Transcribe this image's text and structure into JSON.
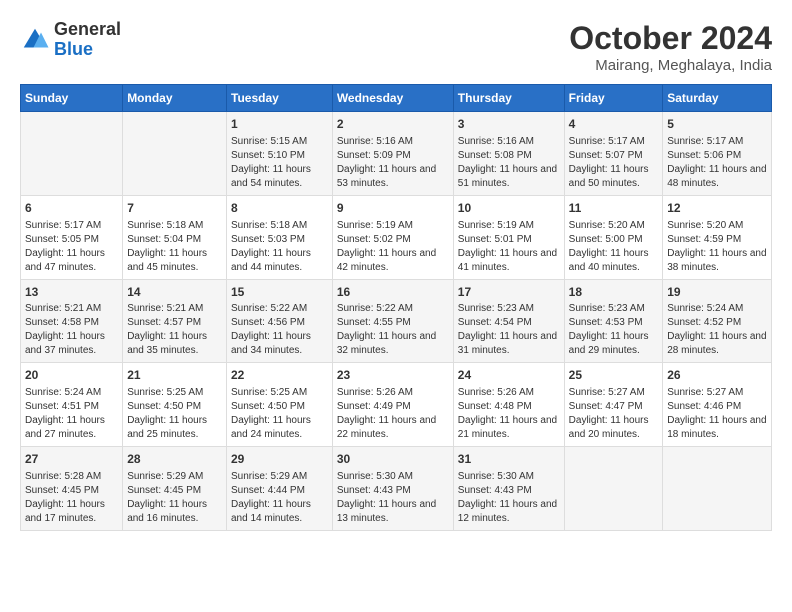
{
  "header": {
    "logo_general": "General",
    "logo_blue": "Blue",
    "month_title": "October 2024",
    "location": "Mairang, Meghalaya, India"
  },
  "weekdays": [
    "Sunday",
    "Monday",
    "Tuesday",
    "Wednesday",
    "Thursday",
    "Friday",
    "Saturday"
  ],
  "weeks": [
    [
      {
        "day": "",
        "content": ""
      },
      {
        "day": "",
        "content": ""
      },
      {
        "day": "1",
        "content": "Sunrise: 5:15 AM\nSunset: 5:10 PM\nDaylight: 11 hours and 54 minutes."
      },
      {
        "day": "2",
        "content": "Sunrise: 5:16 AM\nSunset: 5:09 PM\nDaylight: 11 hours and 53 minutes."
      },
      {
        "day": "3",
        "content": "Sunrise: 5:16 AM\nSunset: 5:08 PM\nDaylight: 11 hours and 51 minutes."
      },
      {
        "day": "4",
        "content": "Sunrise: 5:17 AM\nSunset: 5:07 PM\nDaylight: 11 hours and 50 minutes."
      },
      {
        "day": "5",
        "content": "Sunrise: 5:17 AM\nSunset: 5:06 PM\nDaylight: 11 hours and 48 minutes."
      }
    ],
    [
      {
        "day": "6",
        "content": "Sunrise: 5:17 AM\nSunset: 5:05 PM\nDaylight: 11 hours and 47 minutes."
      },
      {
        "day": "7",
        "content": "Sunrise: 5:18 AM\nSunset: 5:04 PM\nDaylight: 11 hours and 45 minutes."
      },
      {
        "day": "8",
        "content": "Sunrise: 5:18 AM\nSunset: 5:03 PM\nDaylight: 11 hours and 44 minutes."
      },
      {
        "day": "9",
        "content": "Sunrise: 5:19 AM\nSunset: 5:02 PM\nDaylight: 11 hours and 42 minutes."
      },
      {
        "day": "10",
        "content": "Sunrise: 5:19 AM\nSunset: 5:01 PM\nDaylight: 11 hours and 41 minutes."
      },
      {
        "day": "11",
        "content": "Sunrise: 5:20 AM\nSunset: 5:00 PM\nDaylight: 11 hours and 40 minutes."
      },
      {
        "day": "12",
        "content": "Sunrise: 5:20 AM\nSunset: 4:59 PM\nDaylight: 11 hours and 38 minutes."
      }
    ],
    [
      {
        "day": "13",
        "content": "Sunrise: 5:21 AM\nSunset: 4:58 PM\nDaylight: 11 hours and 37 minutes."
      },
      {
        "day": "14",
        "content": "Sunrise: 5:21 AM\nSunset: 4:57 PM\nDaylight: 11 hours and 35 minutes."
      },
      {
        "day": "15",
        "content": "Sunrise: 5:22 AM\nSunset: 4:56 PM\nDaylight: 11 hours and 34 minutes."
      },
      {
        "day": "16",
        "content": "Sunrise: 5:22 AM\nSunset: 4:55 PM\nDaylight: 11 hours and 32 minutes."
      },
      {
        "day": "17",
        "content": "Sunrise: 5:23 AM\nSunset: 4:54 PM\nDaylight: 11 hours and 31 minutes."
      },
      {
        "day": "18",
        "content": "Sunrise: 5:23 AM\nSunset: 4:53 PM\nDaylight: 11 hours and 29 minutes."
      },
      {
        "day": "19",
        "content": "Sunrise: 5:24 AM\nSunset: 4:52 PM\nDaylight: 11 hours and 28 minutes."
      }
    ],
    [
      {
        "day": "20",
        "content": "Sunrise: 5:24 AM\nSunset: 4:51 PM\nDaylight: 11 hours and 27 minutes."
      },
      {
        "day": "21",
        "content": "Sunrise: 5:25 AM\nSunset: 4:50 PM\nDaylight: 11 hours and 25 minutes."
      },
      {
        "day": "22",
        "content": "Sunrise: 5:25 AM\nSunset: 4:50 PM\nDaylight: 11 hours and 24 minutes."
      },
      {
        "day": "23",
        "content": "Sunrise: 5:26 AM\nSunset: 4:49 PM\nDaylight: 11 hours and 22 minutes."
      },
      {
        "day": "24",
        "content": "Sunrise: 5:26 AM\nSunset: 4:48 PM\nDaylight: 11 hours and 21 minutes."
      },
      {
        "day": "25",
        "content": "Sunrise: 5:27 AM\nSunset: 4:47 PM\nDaylight: 11 hours and 20 minutes."
      },
      {
        "day": "26",
        "content": "Sunrise: 5:27 AM\nSunset: 4:46 PM\nDaylight: 11 hours and 18 minutes."
      }
    ],
    [
      {
        "day": "27",
        "content": "Sunrise: 5:28 AM\nSunset: 4:45 PM\nDaylight: 11 hours and 17 minutes."
      },
      {
        "day": "28",
        "content": "Sunrise: 5:29 AM\nSunset: 4:45 PM\nDaylight: 11 hours and 16 minutes."
      },
      {
        "day": "29",
        "content": "Sunrise: 5:29 AM\nSunset: 4:44 PM\nDaylight: 11 hours and 14 minutes."
      },
      {
        "day": "30",
        "content": "Sunrise: 5:30 AM\nSunset: 4:43 PM\nDaylight: 11 hours and 13 minutes."
      },
      {
        "day": "31",
        "content": "Sunrise: 5:30 AM\nSunset: 4:43 PM\nDaylight: 11 hours and 12 minutes."
      },
      {
        "day": "",
        "content": ""
      },
      {
        "day": "",
        "content": ""
      }
    ]
  ]
}
